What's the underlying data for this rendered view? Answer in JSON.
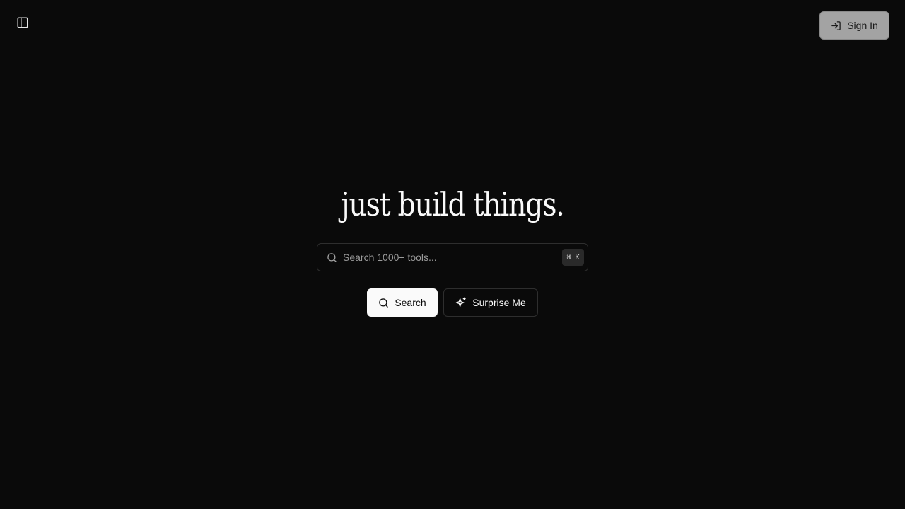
{
  "sidebar": {
    "toggle_icon": "panel-left-icon"
  },
  "header": {
    "signin_label": "Sign In",
    "signin_icon": "log-in-icon"
  },
  "hero": {
    "title": "just build things."
  },
  "search": {
    "placeholder": "Search 1000+ tools...",
    "value": "",
    "icon": "search-icon",
    "shortcut": "⌘ K"
  },
  "actions": {
    "search_label": "Search",
    "search_icon": "search-icon",
    "surprise_label": "Surprise Me",
    "surprise_icon": "sparkles-icon"
  },
  "colors": {
    "background": "#0a0a0a",
    "foreground": "#fafafa",
    "border": "#2e2e2e",
    "signin_bg": "#a3a3a3"
  }
}
